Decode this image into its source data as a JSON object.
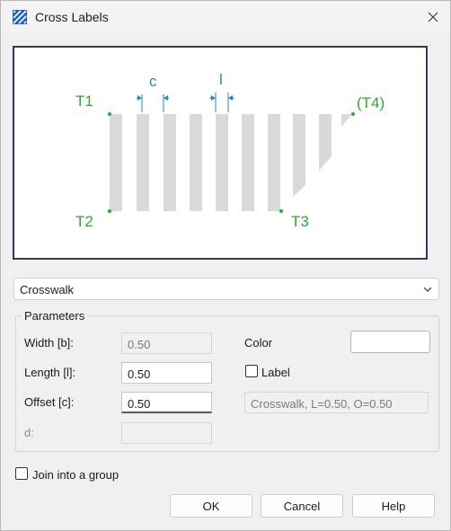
{
  "window": {
    "title": "Cross Labels",
    "app_icon": "hatch-icon",
    "close_icon": "close-icon"
  },
  "preview": {
    "labels": {
      "t1": "T1",
      "t2": "T2",
      "t3": "T3",
      "t4": "(T4)",
      "c": "c",
      "l": "l"
    },
    "colors": {
      "point": "#2fa82f",
      "dimension": "#2a86c8",
      "stripe": "#d9d9d9",
      "border": "#40305a"
    }
  },
  "type_select": {
    "value": "Crosswalk",
    "icon": "chevron-down-icon"
  },
  "parameters": {
    "title": "Parameters",
    "width": {
      "label": "Width [b]:",
      "value": "0.50"
    },
    "length": {
      "label": "Length [l]:",
      "value": "0.50"
    },
    "offset": {
      "label": "Offset [c]:",
      "value": "0.50"
    },
    "d": {
      "label": "d:",
      "value": ""
    },
    "color_label": "Color",
    "label_checkbox": "Label",
    "label_text": "Crosswalk, L=0.50, O=0.50"
  },
  "join_group": "Join into a group",
  "buttons": {
    "ok": "OK",
    "cancel": "Cancel",
    "help": "Help"
  }
}
